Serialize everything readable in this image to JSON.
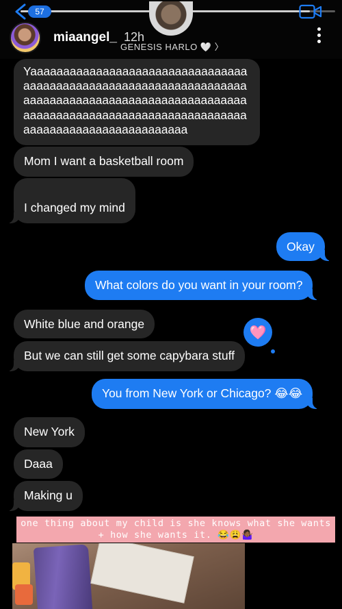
{
  "header": {
    "notification_count": "57",
    "username": "miaangel_",
    "time": "12h",
    "story_label": "GENESIS HARLO 🤍 〉",
    "story_progress": 0.92
  },
  "messages": [
    {
      "side": "in",
      "text": "Yaaaaaaaaaaaaaaaaaaaaaaaaaaaaaaaaaaaaaaaaaaaaaaaaaaaaaaaaaaaaaaaaaaaaaaaaaaaaaaaaaaaaaaaaaaaaaaaaaaaaaaaaaaaaaaaaaaaaaaaaaaaaaaaaaaaaaaaaaaaaaaaaaaaaaaaaaaaaaaaa"
    },
    {
      "side": "in",
      "text": "Mom I want a basketball room"
    },
    {
      "side": "in",
      "text": "I changed my mind"
    },
    {
      "side": "out",
      "text": "Okay"
    },
    {
      "side": "out",
      "text": "What colors do you want in your room?"
    },
    {
      "side": "in",
      "text": "White blue and orange"
    },
    {
      "side": "in",
      "text": "But we can still get some capybara stuff"
    },
    {
      "side": "out",
      "text": "You from New York or Chicago? 😂😂"
    },
    {
      "side": "in",
      "text": "New York"
    },
    {
      "side": "in",
      "text": "Daaa"
    },
    {
      "side": "in",
      "text": "Making u"
    }
  ],
  "reaction": {
    "emoji": "🩷",
    "icon": "heart-icon"
  },
  "caption": "one thing about my child is she knows what she wants + how she wants it. 😂😩🤷🏾‍♀️",
  "colors": {
    "incoming_bubble": "#262626",
    "outgoing_bubble": "#1e7cf2",
    "caption_bg": "#f3a7ae",
    "badge": "#1d6fe0"
  }
}
